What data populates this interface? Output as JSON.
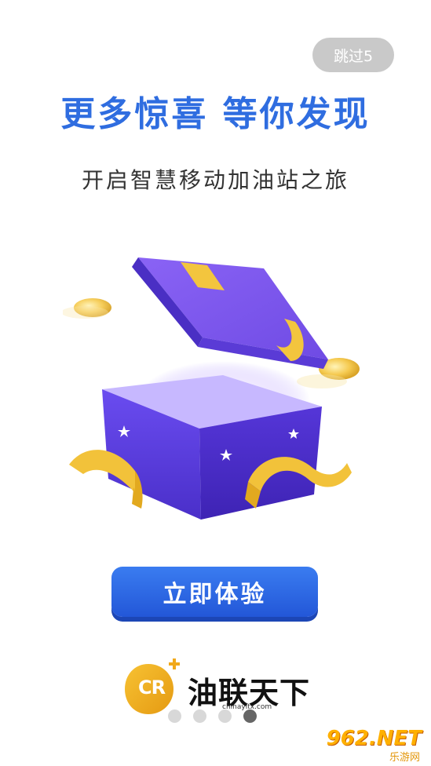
{
  "skip_button": {
    "label": "跳过5"
  },
  "headline": "更多惊喜 等你发现",
  "subtitle": "开启智慧移动加油站之旅",
  "cta": {
    "label": "立即体验"
  },
  "brand": {
    "logo_text": "CR",
    "name": "油联天下",
    "url": "chinayltx.com"
  },
  "pagination": {
    "total": 4,
    "active_index": 3
  },
  "watermark": {
    "main": "962.NET",
    "sub": "乐游网"
  },
  "colors": {
    "headline": "#2f6de0",
    "cta": "#2a63dd",
    "skip": "#c9c9c9",
    "box": "#5b3fd9",
    "ribbon": "#f2c23a"
  },
  "icons": [
    "gift-box-illustration",
    "gold-coin-icon",
    "star-icon",
    "cr-logo-icon"
  ]
}
